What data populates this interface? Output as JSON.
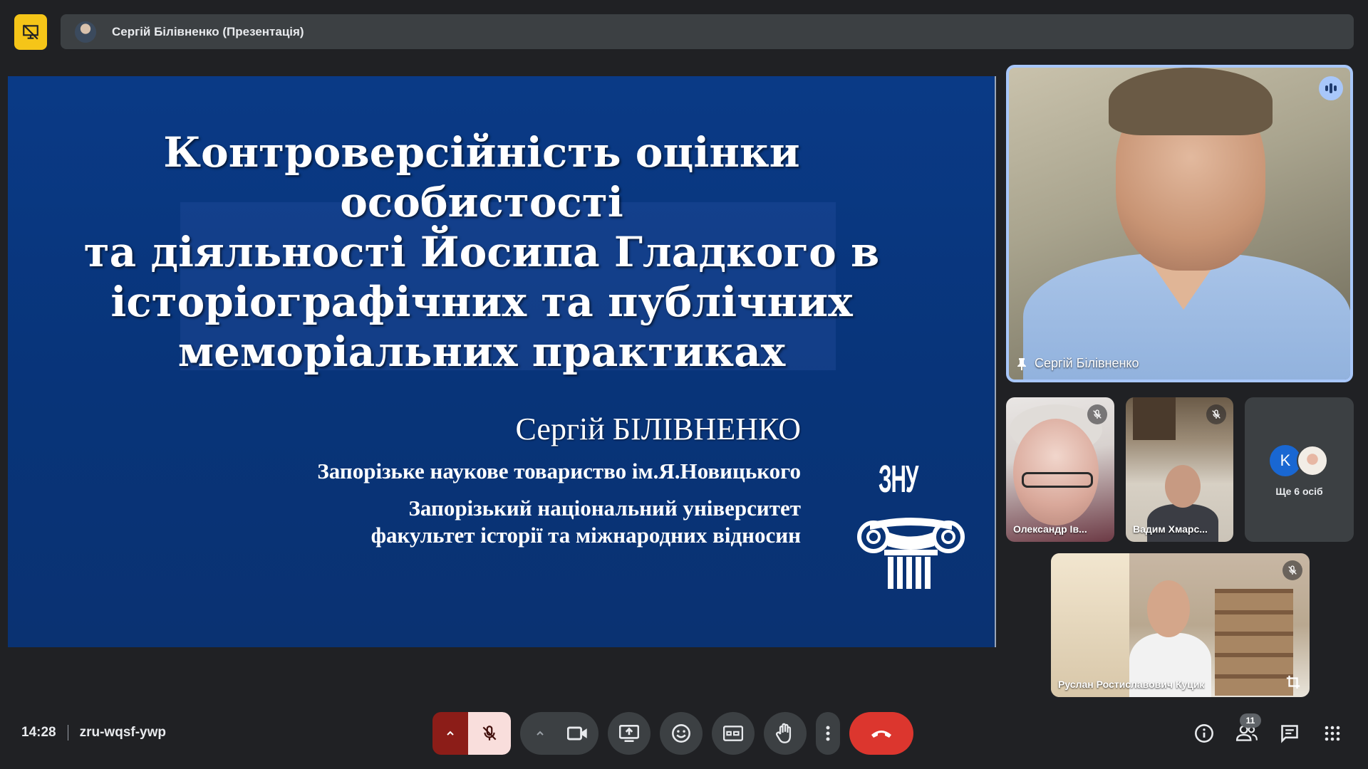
{
  "header": {
    "presentation_title": "Сергій Білівненко (Презентація)"
  },
  "slide": {
    "title_lines": [
      "Контроверсійність оцінки особистості",
      "та діяльності Йосипа Гладкого в",
      "історіографічних та публічних",
      "меморіальних практиках"
    ],
    "author": "Сергій БІЛІВНЕНКО",
    "org1": "Запорізьке наукове товариство ім.Я.Новицького",
    "org2_line1": "Запорізький національний університет",
    "org2_line2": "факультет історії та міжнародних відносин",
    "logo_text": "ЗНУ",
    "background_color": "#0a3a86"
  },
  "participants": {
    "main": {
      "name": "Сергій Білівненко",
      "speaking": true
    },
    "tiles": [
      {
        "name": "Олександр Ів...",
        "muted": true
      },
      {
        "name": "Вадим Хмарс...",
        "muted": true
      },
      {
        "name": "Руслан Ростиславович Куцик",
        "muted": true
      }
    ],
    "more": {
      "avatar_letter": "K",
      "label": "Ще 6 осіб"
    }
  },
  "footer": {
    "time": "14:28",
    "meeting_code": "zru-wqsf-ywp",
    "participant_count": "11"
  },
  "colors": {
    "accent": "#a8c7fa",
    "end_call": "#dc362e",
    "mic_muted_bg": "#f9dedc",
    "mic_caret_bg": "#8c1d18",
    "present_badge": "#f5c518"
  }
}
